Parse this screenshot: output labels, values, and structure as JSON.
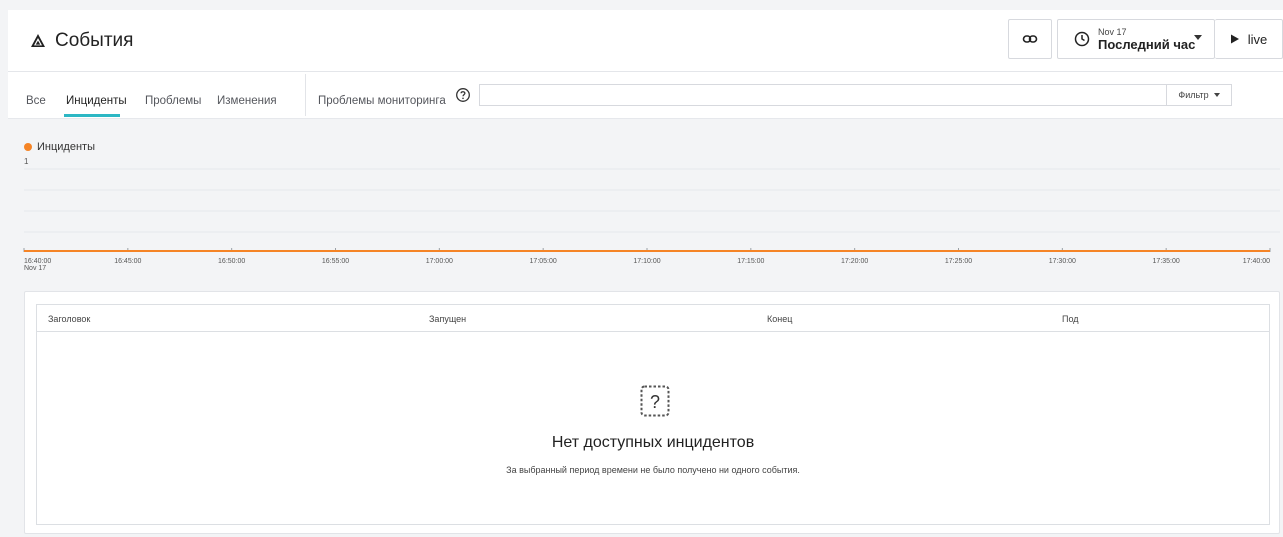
{
  "header": {
    "title": "События",
    "time_picker": {
      "date": "Nov 17",
      "range": "Последний час"
    },
    "live_label": "live"
  },
  "tabs": [
    "Все",
    "Инциденты",
    "Проблемы",
    "Изменения",
    "Проблемы мониторинга"
  ],
  "active_tab": "Инциденты",
  "search": {
    "value": "",
    "placeholder": ""
  },
  "filter_label": "Фильтр",
  "chart_data": {
    "type": "line",
    "legend": [
      "Инциденты"
    ],
    "series": [
      {
        "name": "Инциденты",
        "color": "#f58426",
        "values": [
          0,
          0,
          0,
          0,
          0,
          0,
          0,
          0,
          0,
          0,
          0,
          0,
          0
        ]
      }
    ],
    "x": [
      "16:40:00",
      "16:45:00",
      "16:50:00",
      "16:55:00",
      "17:00:00",
      "17:05:00",
      "17:10:00",
      "17:15:00",
      "17:20:00",
      "17:25:00",
      "17:30:00",
      "17:35:00",
      "17:40:00"
    ],
    "x_sub_label": "Nov 17",
    "y_ticks": [
      "1"
    ],
    "ylim": [
      0,
      1
    ],
    "grid": true
  },
  "table": {
    "columns": [
      "Заголовок",
      "Запущен",
      "Конец",
      "Под"
    ],
    "empty_title": "Нет доступных инцидентов",
    "empty_description": "За выбранный период времени не было получено ни одного события."
  },
  "colors": {
    "accent": "#2db7c4",
    "series": "#f58426"
  }
}
